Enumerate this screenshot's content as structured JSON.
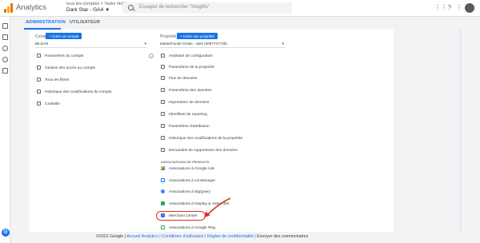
{
  "header": {
    "app_title": "Analytics",
    "account_path": "tous les comptes > Vador Holding",
    "account_name": "Dark Star - GA4",
    "search_placeholder": "Essayez de rechercher \"Insights\""
  },
  "tabs": [
    {
      "label": "ADMINISTRATION",
      "active": true
    },
    {
      "label": "UTILISATEUR",
      "active": false
    }
  ],
  "account_column": {
    "heading": "Compte",
    "create_button": "+ Créer un compte",
    "selected": "BiLDAN",
    "items": [
      {
        "label": "Paramètres du compte",
        "icon": "building-icon"
      },
      {
        "label": "Gestion des accès au compte",
        "icon": "people-icon"
      },
      {
        "label": "Tous les filtres",
        "icon": "filter-icon"
      },
      {
        "label": "Historique des modifications du compte",
        "icon": "history-icon"
      },
      {
        "label": "Corbeille",
        "icon": "trash-icon"
      }
    ]
  },
  "property_column": {
    "heading": "Propriété",
    "create_button": "+ Créer une propriété",
    "selected": "Masterhunde Grade - dark (3087707748)",
    "items": [
      {
        "label": "Assistant de configuration",
        "icon": "checklist-icon"
      },
      {
        "label": "Paramètres de la propriété",
        "icon": "settings-page-icon"
      },
      {
        "label": "Flux de données",
        "icon": "data-stream-icon"
      },
      {
        "label": "Paramètres des données",
        "icon": "database-icon"
      },
      {
        "label": "Importation de données",
        "icon": "upload-icon"
      },
      {
        "label": "Identifiant de reporting",
        "icon": "id-icon"
      },
      {
        "label": "Paramètres d'attribution",
        "icon": "attribution-icon"
      },
      {
        "label": "Historique des modifications de la propriété",
        "icon": "history-icon"
      },
      {
        "label": "Demandes de suppression des données",
        "icon": "delete-data-icon"
      }
    ],
    "section_heading": "ASSOCIATIONS DE PRODUITS",
    "products": [
      {
        "label": "Associations à Google Ads",
        "icon": "google-ads-icon"
      },
      {
        "label": "Associations à Ad Manager",
        "icon": "ad-manager-icon"
      },
      {
        "label": "Associations à BigQuery",
        "icon": "bigquery-icon"
      },
      {
        "label": "Associations à Display & Video 360",
        "icon": "dv360-icon"
      },
      {
        "label": "Merchant Center",
        "icon": "merchant-center-icon"
      },
      {
        "label": "Associations à Google Play",
        "icon": "google-play-icon"
      }
    ]
  },
  "footer": {
    "copyright": "©2022 Google |",
    "link_home": "Accueil Analytics",
    "sep1": "|",
    "link_terms": "Conditions d'utilisation",
    "sep2": "|",
    "link_privacy": "Règles de confidentialité",
    "sep3": "|",
    "feedback": "Envoyer des commentaires"
  },
  "colors": {
    "accent": "#1a73e8",
    "highlight": "#d93025"
  }
}
